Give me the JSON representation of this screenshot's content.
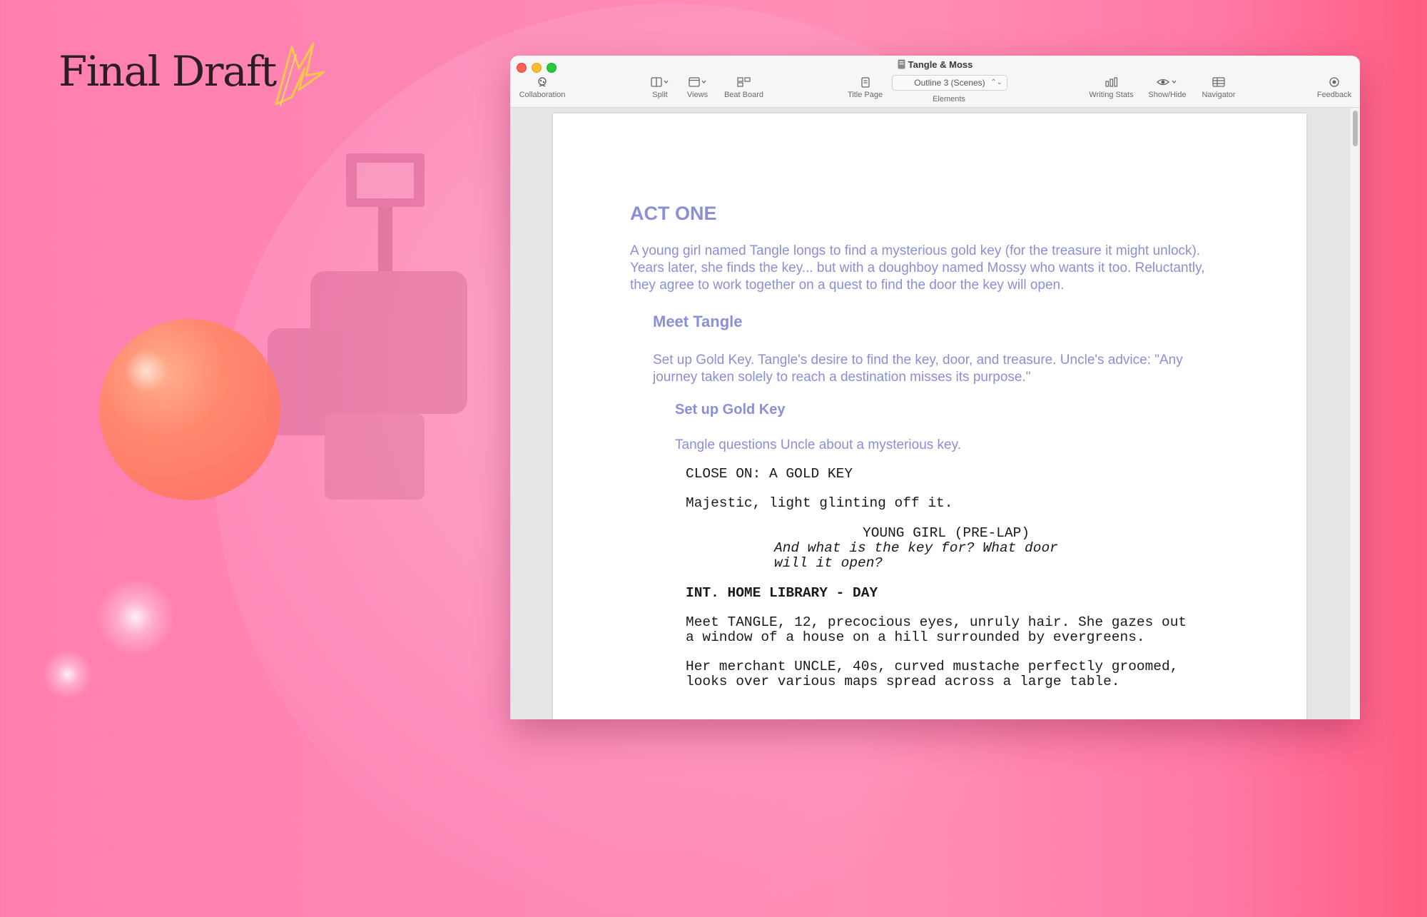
{
  "brand": {
    "name": "Final Draft"
  },
  "window": {
    "title": "Tangle & Moss",
    "toolbar": {
      "collaboration": "Collaboration",
      "split": "Split",
      "views": "Views",
      "beat_board": "Beat Board",
      "title_page": "Title Page",
      "elements_value": "Outline 3 (Scenes)",
      "elements_label": "Elements",
      "writing_stats": "Writing Stats",
      "show_hide": "Show/Hide",
      "navigator": "Navigator",
      "feedback": "Feedback"
    }
  },
  "script": {
    "act_title": "ACT ONE",
    "act_summary": "A young girl named Tangle longs to find a mysterious gold key (for the treasure it might unlock). Years later, she finds the key... but with a doughboy named Mossy who wants it too. Reluctantly, they agree to work together on a quest to find the door the key will open.",
    "sequence_title": "Meet Tangle",
    "sequence_summary": "Set up Gold Key. Tangle's desire to find the key, door, and treasure. Uncle's advice: \"Any journey taken solely to reach a destination misses its purpose.\"",
    "scene_title": "Set up Gold Key",
    "scene_summary": "Tangle questions Uncle about a mysterious key.",
    "action_1": "CLOSE ON: A GOLD KEY",
    "action_2": "Majestic, light glinting off it.",
    "character": "YOUNG GIRL (PRE-LAP)",
    "dialogue": "And what is the key for? What door\nwill it open?",
    "scene_heading": "INT. HOME LIBRARY - DAY",
    "action_3": "Meet TANGLE, 12, precocious eyes, unruly hair. She gazes out\na window of a house on a hill surrounded by evergreens.",
    "action_4": "Her merchant UNCLE, 40s, curved mustache perfectly groomed,\nlooks over various maps spread across a large table."
  }
}
